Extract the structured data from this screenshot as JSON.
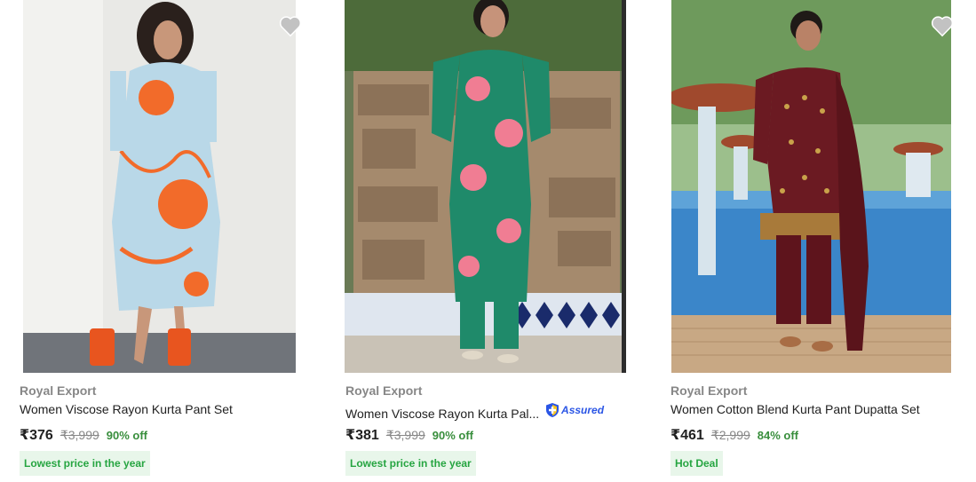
{
  "products": [
    {
      "brand": "Royal Export",
      "title": "Women Viscose Rayon Kurta Pant Set",
      "price": "₹376",
      "mrp": "₹3,999",
      "discount": "90% off",
      "tag": "Lowest price in the year",
      "image": "woman-in-blue-orange-floral-kurta"
    },
    {
      "brand": "Royal Export",
      "title": "Women Viscose Rayon Kurta Pal...",
      "assured": "Assured",
      "price": "₹381",
      "mrp": "₹3,999",
      "discount": "90% off",
      "tag": "Lowest price in the year",
      "image": "woman-in-green-pink-floral-kurta"
    },
    {
      "brand": "Royal Export",
      "title": "Women Cotton Blend Kurta Pant Dupatta Set",
      "price": "₹461",
      "mrp": "₹2,999",
      "discount": "84% off",
      "tag": "Hot Deal",
      "image": "woman-in-maroon-kurta-dupatta"
    }
  ],
  "colors": {
    "discount": "#388e3c",
    "tag_bg": "#e8f6ea",
    "assured": "#2a55e5"
  }
}
